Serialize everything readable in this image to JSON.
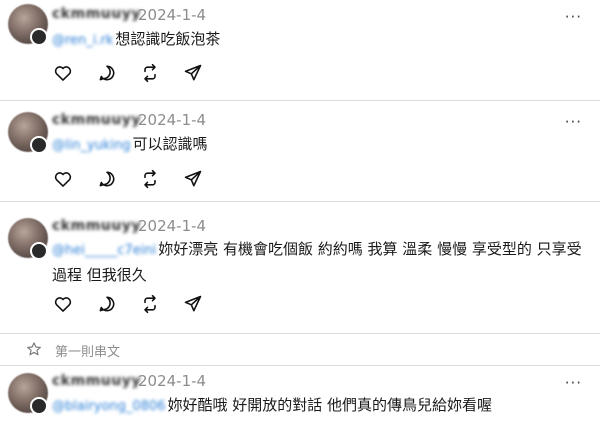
{
  "posts": [
    {
      "username": "ckmmuuyy",
      "date": "2024-1-4",
      "mention": "@ren_i.rk",
      "text": "想認識吃飯泡茶"
    },
    {
      "username": "ckmmuuyy",
      "date": "2024-1-4",
      "mention": "@lin_yuking",
      "text": "可以認識嗎"
    },
    {
      "username": "ckmmuuyy",
      "date": "2024-1-4",
      "mention": "@hei_____c7eini",
      "text": "妳好漂亮 有機會吃個飯 約約嗎 我算 溫柔 慢慢 享受型的 只享受過程 但我很久"
    },
    {
      "username": "ckmmuuyy",
      "date": "2024-1-4",
      "mention": "@blairyong_0806",
      "text": "妳好酷哦 好開放的對話 他們真的傳鳥兒給妳看喔"
    }
  ],
  "thread_label": "第一則串文",
  "more_label": "···",
  "actions": [
    "heart-icon",
    "comment-icon",
    "repost-icon",
    "share-icon"
  ]
}
